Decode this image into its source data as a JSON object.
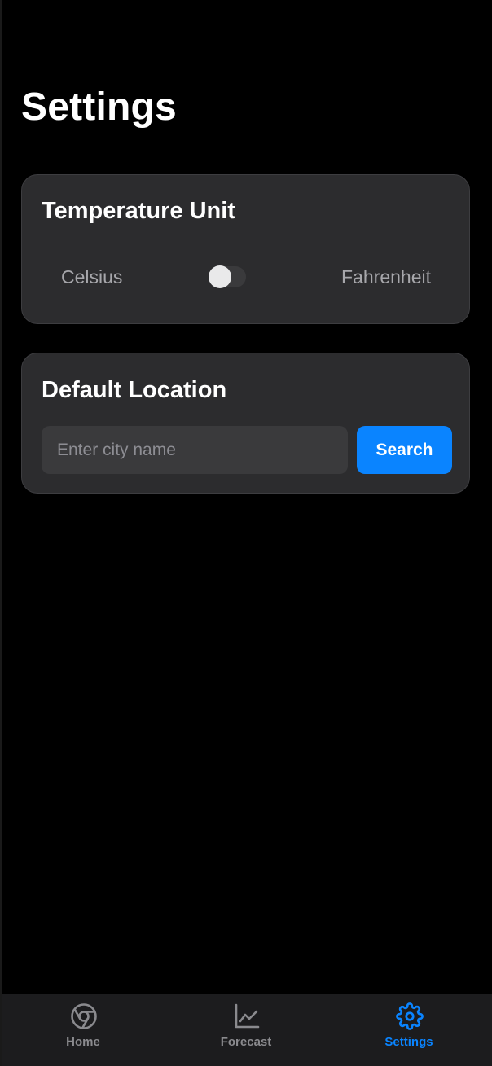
{
  "page": {
    "title": "Settings"
  },
  "temperature_card": {
    "title": "Temperature Unit",
    "left_label": "Celsius",
    "right_label": "Fahrenheit",
    "toggle_on": false
  },
  "location_card": {
    "title": "Default Location",
    "input_value": "",
    "input_placeholder": "Enter city name",
    "search_label": "Search"
  },
  "tabbar": {
    "tabs": [
      {
        "label": "Home",
        "icon": "home-icon",
        "active": false
      },
      {
        "label": "Forecast",
        "icon": "chart-line-icon",
        "active": false
      },
      {
        "label": "Settings",
        "icon": "gear-icon",
        "active": true
      }
    ]
  },
  "colors": {
    "background": "#000000",
    "card": "#2c2c2e",
    "accent": "#0a84ff",
    "inactive_tab": "#8a8a8e",
    "muted_text": "#a7a7ab"
  }
}
